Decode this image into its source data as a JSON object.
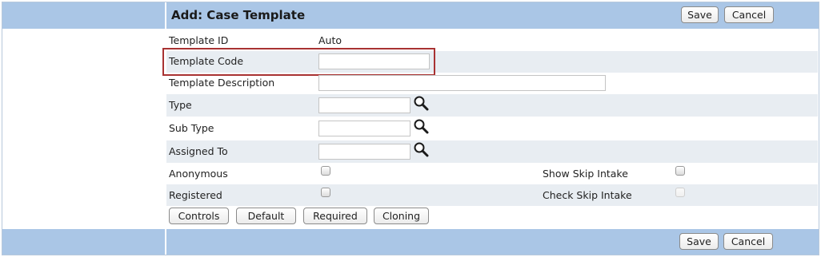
{
  "header": {
    "title": "Add: Case Template",
    "save_label": "Save",
    "cancel_label": "Cancel"
  },
  "form": {
    "template_id": {
      "label": "Template ID",
      "value": "Auto"
    },
    "template_code": {
      "label": "Template Code",
      "value": ""
    },
    "template_description": {
      "label": "Template Description",
      "value": ""
    },
    "type": {
      "label": "Type",
      "value": ""
    },
    "sub_type": {
      "label": "Sub Type",
      "value": ""
    },
    "assigned_to": {
      "label": "Assigned To",
      "value": ""
    },
    "anonymous": {
      "label": "Anonymous",
      "checked": false
    },
    "show_skip_intake": {
      "label": "Show Skip Intake",
      "checked": false
    },
    "registered": {
      "label": "Registered",
      "checked": false
    },
    "check_skip_intake": {
      "label": "Check Skip Intake",
      "checked": false,
      "disabled": true
    }
  },
  "actions": {
    "controls_label": "Controls",
    "default_label": "Default",
    "required_label": "Required",
    "cloning_label": "Cloning"
  },
  "footer": {
    "save_label": "Save",
    "cancel_label": "Cancel"
  },
  "icons": {
    "lookup": "magnifier-icon"
  },
  "colors": {
    "header_band": "#aac6e6",
    "row_shade": "#e8edf2",
    "highlight_border": "#a83232"
  }
}
